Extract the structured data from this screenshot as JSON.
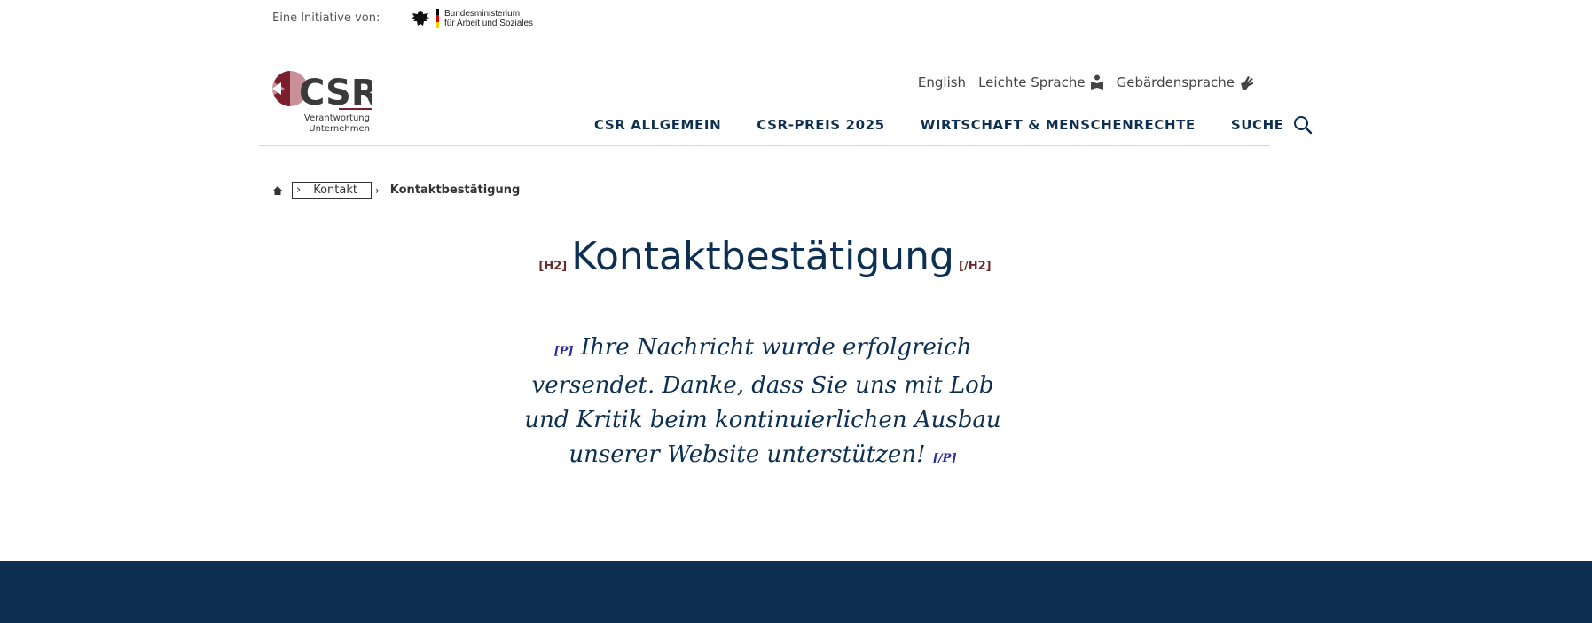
{
  "topbar": {
    "initiative_label": "Eine Initiative von:",
    "ministry_line1": "Bundesministerium",
    "ministry_line2": "für Arbeit und Soziales"
  },
  "logo": {
    "brand": "CSR",
    "sub_line1": "Verantwortung",
    "sub_line2": "Unternehmen",
    "colors": {
      "maroon": "#7a1f2b",
      "pink": "#c9909a",
      "dark": "#3a3a3a"
    }
  },
  "service_nav": {
    "english": "English",
    "easy_language": "Leichte Sprache",
    "sign_language": "Gebärdensprache"
  },
  "main_nav": {
    "items": [
      "CSR ALLGEMEIN",
      "CSR-PREIS 2025",
      "WIRTSCHAFT & MENSCHENRECHTE",
      "SUCHE"
    ]
  },
  "breadcrumb": {
    "home_icon": "home-icon",
    "items": [
      "Kontakt",
      "Kontaktbestätigung"
    ]
  },
  "heading": {
    "open_tag": "[H2]",
    "text": "Kontaktbestätigung",
    "close_tag": "[/H2]"
  },
  "message": {
    "open_tag": "[P]",
    "text": "Ihre Nachricht wurde erfolgreich versendet. Danke, dass Sie uns mit Lob und Kritik beim kontinuierlichen Ausbau unserer Website unterstützen!",
    "close_tag": "[/P]"
  },
  "colors": {
    "primary": "#0c2f52",
    "footer": "#0c2f52"
  }
}
